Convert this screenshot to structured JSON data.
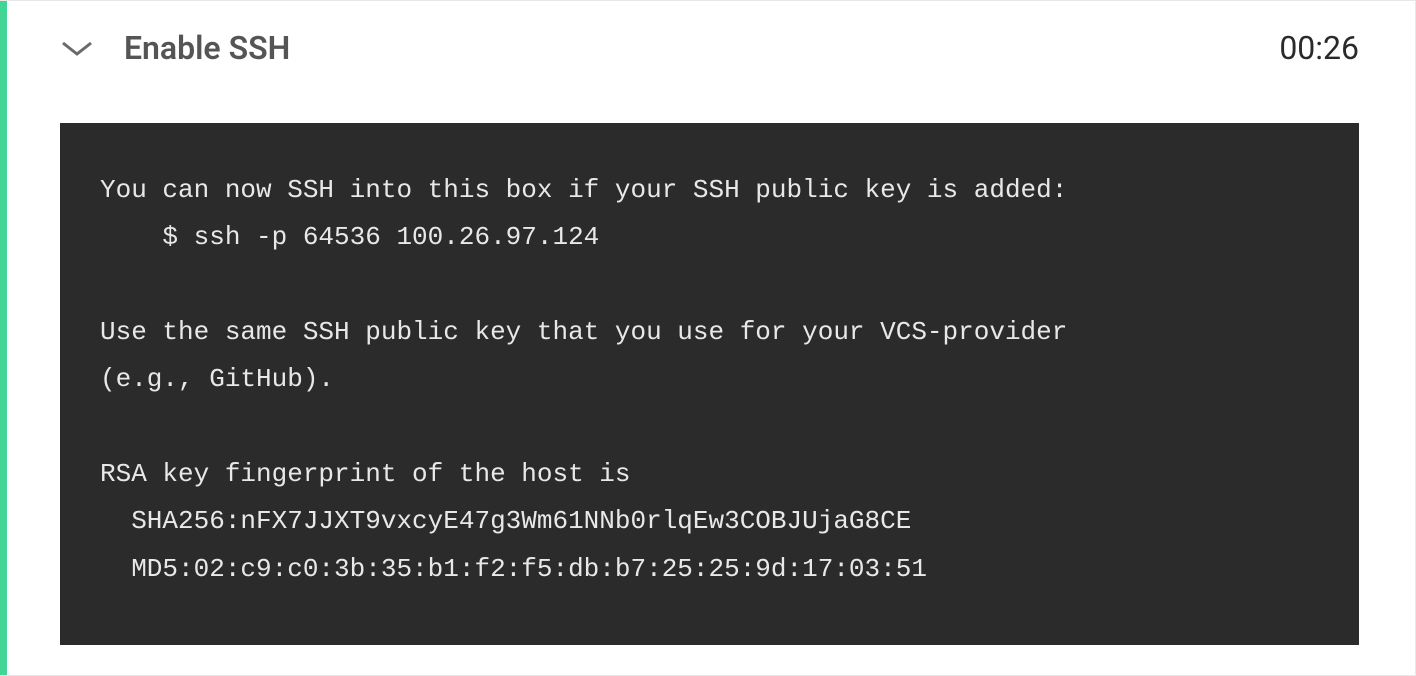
{
  "header": {
    "title": "Enable SSH",
    "duration": "00:26"
  },
  "terminal": {
    "line1": "You can now SSH into this box if your SSH public key is added:",
    "line2": "    $ ssh -p 64536 100.26.97.124",
    "line3": "",
    "line4": "Use the same SSH public key that you use for your VCS-provider",
    "line5": "(e.g., GitHub).",
    "line6": "",
    "line7": "RSA key fingerprint of the host is",
    "line8": "  SHA256:nFX7JJXT9vxcyE47g3Wm61NNb0rlqEw3COBJUjaG8CE",
    "line9": "  MD5:02:c9:c0:3b:35:b1:f2:f5:db:b7:25:25:9d:17:03:51"
  }
}
